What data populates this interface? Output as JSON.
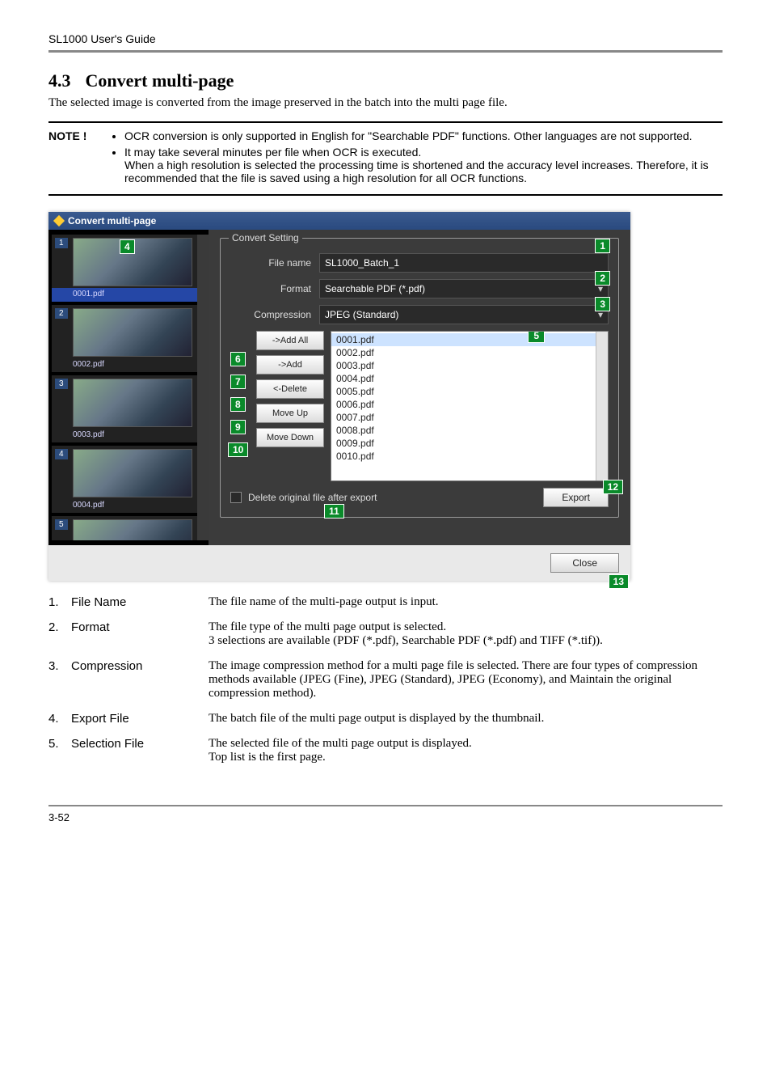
{
  "running_head": "SL1000 User's Guide",
  "section_number": "4.3",
  "section_title": "Convert multi-page",
  "intro": "The selected image is converted from the image preserved in the batch into the multi page file.",
  "note": {
    "label": "NOTE !",
    "bullets": [
      "OCR conversion is only supported in English for \"Searchable PDF\" functions. Other languages are not supported.",
      "It may take several minutes per file when OCR is executed.\nWhen a high resolution is selected the processing time is shortened and the accuracy level increases.    Therefore, it is recommended that the file is saved using a high resolution for all OCR functions."
    ]
  },
  "app": {
    "title": "Convert multi-page",
    "legend": "Convert Setting",
    "fields": {
      "file_name_label": "File name",
      "file_name_value": "SL1000_Batch_1",
      "format_label": "Format",
      "format_value": "Searchable PDF (*.pdf)",
      "compression_label": "Compression",
      "compression_value": "JPEG (Standard)"
    },
    "buttons": {
      "add_all": "->Add All",
      "add": "->Add",
      "delete": "<-Delete",
      "move_up": "Move Up",
      "move_down": "Move Down",
      "export": "Export",
      "close": "Close"
    },
    "delete_original": "Delete original file after export",
    "thumbnails": [
      {
        "num": "1",
        "label": "0001.pdf"
      },
      {
        "num": "2",
        "label": "0002.pdf"
      },
      {
        "num": "3",
        "label": "0003.pdf"
      },
      {
        "num": "4",
        "label": "0004.pdf"
      },
      {
        "num": "5",
        "label": ""
      }
    ],
    "file_list": [
      "0001.pdf",
      "0002.pdf",
      "0003.pdf",
      "0004.pdf",
      "0005.pdf",
      "0006.pdf",
      "0007.pdf",
      "0008.pdf",
      "0009.pdf",
      "0010.pdf"
    ],
    "callouts": {
      "c1": "1",
      "c2": "2",
      "c3": "3",
      "c4": "4",
      "c5": "5",
      "c6": "6",
      "c7": "7",
      "c8": "8",
      "c9": "9",
      "c10": "10",
      "c11": "11",
      "c12": "12",
      "c13": "13"
    }
  },
  "definitions": [
    {
      "num": "1.",
      "term": "File Name",
      "desc": "The file name of the multi-page output is input."
    },
    {
      "num": "2.",
      "term": "Format",
      "desc": "The file type of the multi page output is selected.\n3 selections are available (PDF (*.pdf), Searchable PDF (*.pdf) and TIFF (*.tif))."
    },
    {
      "num": "3.",
      "term": "Compression",
      "desc": "The image compression method for a multi page file is selected. There are four types of compression methods available (JPEG (Fine), JPEG (Standard), JPEG (Economy), and Maintain the original compression method)."
    },
    {
      "num": "4.",
      "term": "Export File",
      "desc": "The batch file of the multi page output is displayed by the thumbnail."
    },
    {
      "num": "5.",
      "term": "Selection File",
      "desc": "The selected file of the multi page output is displayed.\nTop list is the first page."
    }
  ],
  "footer": "3-52"
}
